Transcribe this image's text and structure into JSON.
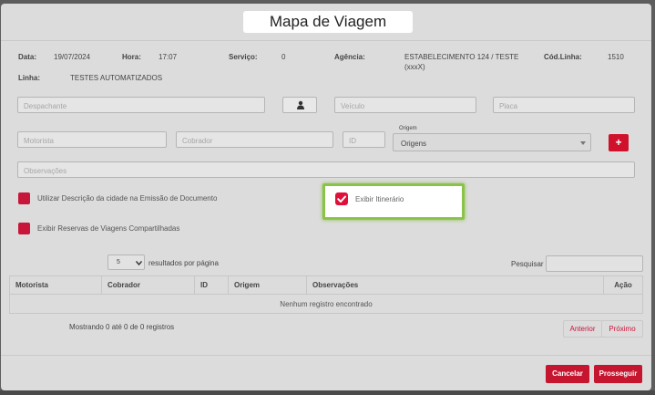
{
  "modal": {
    "title": "Mapa de Viagem"
  },
  "info": {
    "data_label": "Data:",
    "data_value": "19/07/2024",
    "hora_label": "Hora:",
    "hora_value": "17:07",
    "servico_label": "Serviço:",
    "servico_value": "0",
    "agencia_label": "Agência:",
    "agencia_value": "ESTABELECIMENTO 124 / TESTE",
    "agencia_value2": "(xxxX)",
    "codlinha_label": "Cód.Linha:",
    "codlinha_value": "1510",
    "linha_label": "Linha:",
    "linha_value": "TESTES AUTOMATIZADOS"
  },
  "form": {
    "despachante_placeholder": "Despachante",
    "veiculo_placeholder": "Veículo",
    "placa_placeholder": "Placa",
    "motorista_placeholder": "Motorista",
    "cobrador_placeholder": "Cobrador",
    "id_placeholder": "ID",
    "origem_label": "Origem",
    "origem_value": "Origens",
    "observacoes_placeholder": "Observações",
    "add_symbol": "+"
  },
  "options": {
    "utilizar_descricao": "Utilizar Descrição da cidade na Emissão de Documento",
    "exibir_itinerario": "Exibir Itinerário",
    "exibir_reservas": "Exibir Reservas de Viagens Compartilhadas"
  },
  "table": {
    "page_size": "5",
    "per_page_label": "resultados por página",
    "search_label": "Pesquisar",
    "headers": [
      "Motorista",
      "Cobrador",
      "ID",
      "Origem",
      "Observações",
      "Ação"
    ],
    "empty_text": "Nenhum registro encontrado",
    "info_text": "Mostrando 0 até 0 de 0 registros",
    "prev_label": "Anterior",
    "next_label": "Próximo"
  },
  "footer": {
    "cancel_label": "Cancelar",
    "proceed_label": "Prosseguir"
  },
  "colors": {
    "accent": "#d0112b",
    "highlight": "#8bc34a"
  }
}
